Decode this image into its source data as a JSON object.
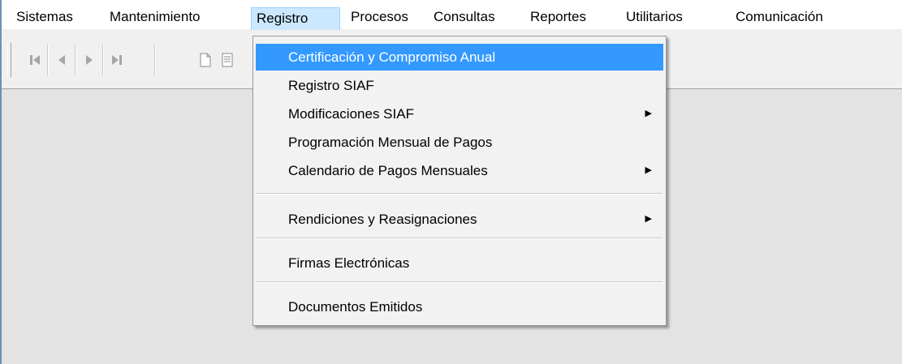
{
  "menubar": {
    "items": [
      "Sistemas",
      "Mantenimiento",
      "Registro",
      "Procesos",
      "Consultas",
      "Reportes",
      "Utilitarios",
      "Comunicación"
    ],
    "active": "Registro"
  },
  "toolbar": {
    "buttons": [
      "first-record-icon",
      "previous-record-icon",
      "next-record-icon",
      "last-record-icon",
      "new-document-icon",
      "list-icon"
    ]
  },
  "dropdown": {
    "items": [
      {
        "label": "Certificación y Compromiso Anual",
        "highlighted": true,
        "submenu": false
      },
      {
        "label": "Registro SIAF",
        "highlighted": false,
        "submenu": false
      },
      {
        "label": "Modificaciones SIAF",
        "highlighted": false,
        "submenu": true
      },
      {
        "label": "Programación Mensual de Pagos",
        "highlighted": false,
        "submenu": false
      },
      {
        "label": "Calendario de Pagos Mensuales",
        "highlighted": false,
        "submenu": true
      },
      {
        "label": "Rendiciones y Reasignaciones",
        "highlighted": false,
        "submenu": true
      },
      {
        "label": "Firmas Electrónicas",
        "highlighted": false,
        "submenu": false
      },
      {
        "label": "Documentos Emitidos",
        "highlighted": false,
        "submenu": false
      }
    ],
    "highlight_color": "#3399ff"
  }
}
